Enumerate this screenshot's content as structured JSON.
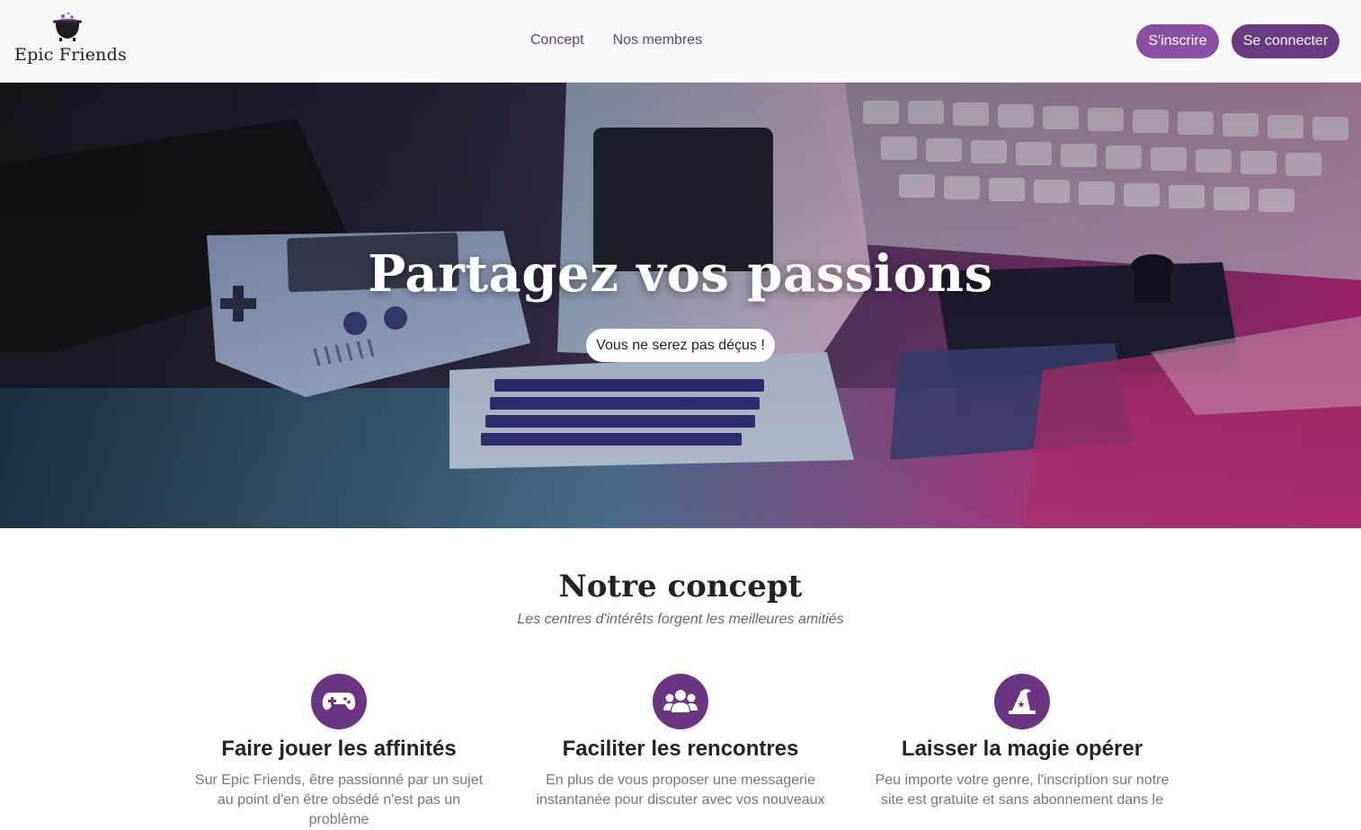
{
  "brand": {
    "name": "Epic Friends",
    "icon": "cauldron-icon"
  },
  "nav": {
    "links": [
      {
        "label": "Concept"
      },
      {
        "label": "Nos membres"
      }
    ]
  },
  "auth": {
    "signup_label": "S'inscrire",
    "login_label": "Se connecter"
  },
  "hero": {
    "title": "Partagez vos passions",
    "pill": "Vous ne serez pas déçus !",
    "image": "retro-computers-and-game-consoles-photo"
  },
  "concept": {
    "title": "Notre concept",
    "subtitle": "Les centres d'intérêts forgent les meilleures amitiés",
    "features": [
      {
        "icon": "gamepad-icon",
        "title": "Faire jouer les affinités",
        "text": "Sur Epic Friends, être passionné par un sujet au point d'en être obsédé n'est pas un problème"
      },
      {
        "icon": "users-icon",
        "title": "Faciliter les rencontres",
        "text": "En plus de vous proposer une messagerie instantanée pour discuter avec vos nouveaux"
      },
      {
        "icon": "wizard-hat-icon",
        "title": "Laisser la magie opérer",
        "text": "Peu importe votre genre, l'inscription sur notre site est gratuite et sans abonnement dans le"
      }
    ]
  },
  "colors": {
    "primary": "#6b3583",
    "signup": "#8a4fa2",
    "login": "#6a3a82",
    "nav_link": "#6b3e80"
  }
}
